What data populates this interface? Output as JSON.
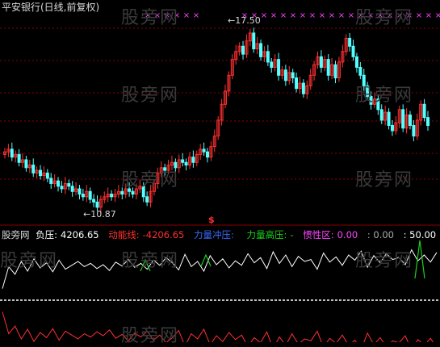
{
  "header": {
    "title": "平安银行(日线,前复权)",
    "watermark": "股旁网"
  },
  "indicator_legend": {
    "name": "股旁网",
    "items": [
      {
        "label": "负压:",
        "value": "4206.65",
        "color": "#ffffff"
      },
      {
        "label": "动能线:",
        "value": "-4206.65",
        "color": "#ff3030"
      },
      {
        "label": "力量冲压:",
        "value": "",
        "color": "#3a6bff"
      },
      {
        "label": "力量高压:",
        "value": "-",
        "color": "#19d219"
      },
      {
        "label": "惯性区:",
        "value": "0.00",
        "color": "#ff44ff"
      },
      {
        "label": "",
        "value": ": 0.00",
        "color": "#aaaaaa"
      },
      {
        "label": "",
        "value": ": 50.00",
        "color": "#ffffff"
      }
    ]
  },
  "annotations": {
    "high": "17.50",
    "low": "10.87",
    "signal_mark": "$"
  },
  "colors": {
    "up": "#ff3030",
    "down": "#54ffff",
    "grid": "#8b0000",
    "signal": "#ff44ff",
    "baseline": "#ffffff"
  },
  "chart_data": [
    {
      "type": "candlestick",
      "title": "平安银行(日线,前复权)",
      "ylim": [
        10.5,
        18.2
      ],
      "max_label": 17.5,
      "min_label": 10.87,
      "close_series": [
        13.0,
        13.1,
        12.8,
        12.9,
        12.6,
        12.7,
        12.4,
        12.5,
        12.2,
        12.3,
        12.1,
        12.2,
        12.0,
        11.8,
        11.9,
        11.7,
        11.6,
        11.8,
        11.7,
        11.5,
        11.6,
        11.4,
        11.3,
        11.5,
        11.2,
        11.1,
        10.9,
        11.2,
        11.3,
        11.4,
        11.3,
        11.4,
        11.5,
        11.4,
        11.6,
        11.5,
        11.4,
        11.6,
        11.7,
        11.3,
        11.1,
        11.5,
        11.8,
        12.2,
        12.4,
        12.3,
        12.5,
        12.6,
        12.4,
        12.7,
        12.6,
        12.5,
        12.8,
        12.6,
        12.9,
        13.1,
        13.0,
        12.8,
        13.2,
        13.6,
        14.2,
        14.8,
        15.3,
        15.9,
        16.5,
        16.8,
        17.0,
        16.7,
        17.2,
        17.5,
        16.9,
        17.1,
        16.6,
        16.8,
        16.4,
        16.2,
        16.5,
        15.9,
        16.1,
        15.7,
        16.0,
        15.8,
        15.4,
        15.6,
        15.2,
        15.5,
        15.9,
        16.3,
        16.6,
        16.2,
        16.5,
        15.9,
        16.3,
        15.8,
        16.4,
        16.8,
        17.3,
        17.0,
        16.6,
        16.2,
        15.9,
        15.5,
        15.1,
        14.8,
        15.0,
        14.6,
        14.2,
        14.5,
        14.0,
        13.8,
        14.1,
        14.6,
        13.9,
        14.4,
        14.0,
        13.6,
        14.2,
        14.8,
        14.3,
        14.0
      ]
    },
    {
      "type": "line",
      "series": [
        {
          "name": "负压",
          "values": [
            18,
            52,
            40,
            60,
            45,
            64,
            50,
            58,
            44,
            62,
            48,
            54,
            60,
            52,
            57,
            49,
            55,
            46,
            59,
            53,
            63,
            51,
            57,
            48,
            62,
            54,
            66,
            58,
            47,
            71,
            52,
            60,
            45,
            69,
            55,
            64,
            50,
            61,
            54,
            72,
            58,
            66,
            49,
            75,
            57,
            70,
            52,
            68,
            60,
            63,
            48,
            73,
            59,
            67,
            54,
            70,
            62,
            76,
            51,
            69,
            58,
            72,
            63,
            66,
            55,
            78,
            61,
            70,
            59,
            74
          ]
        },
        {
          "name": "动能线",
          "values": [
            -18,
            -52,
            -40,
            -60,
            -45,
            -64,
            -50,
            -58,
            -44,
            -62,
            -48,
            -54,
            -60,
            -52,
            -57,
            -49,
            -55,
            -46,
            -59,
            -53,
            -63,
            -51,
            -57,
            -48,
            -62,
            -54,
            -66,
            -58,
            -47,
            -71,
            -52,
            -60,
            -45,
            -69,
            -55,
            -64,
            -50,
            -61,
            -54,
            -72,
            -58,
            -66,
            -49,
            -75,
            -57,
            -70,
            -52,
            -68,
            -60,
            -63,
            -48,
            -73,
            -59,
            -67,
            -54,
            -70,
            -62,
            -76,
            -51,
            -69,
            -58,
            -72,
            -63,
            -66,
            -55,
            -78,
            -61,
            -70,
            -59,
            -74
          ]
        }
      ],
      "baseline": 0
    }
  ]
}
